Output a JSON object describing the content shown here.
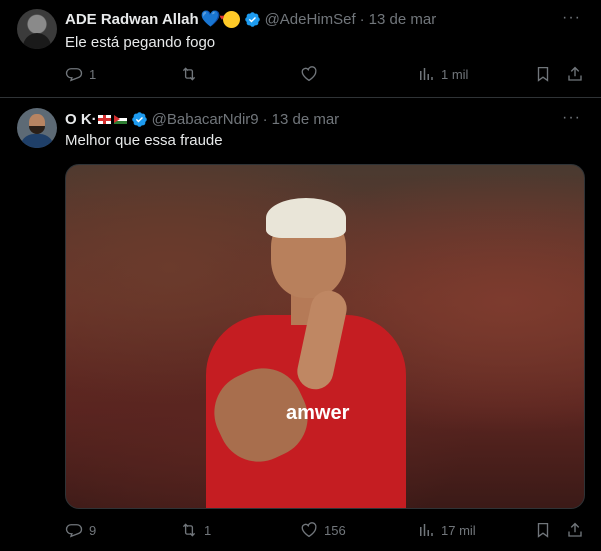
{
  "tweets": [
    {
      "author_name": "ADE Radwan Allah",
      "handle": "@AdeHimSef",
      "date": "13 de mar",
      "text": "Ele está pegando fogo",
      "replies": "1",
      "reposts": "",
      "likes": "",
      "views": "1 mil",
      "verified": true
    },
    {
      "author_name": "O K·",
      "handle": "@BabacarNdir9",
      "date": "13 de mar",
      "text": "Melhor que essa fraude",
      "replies": "9",
      "reposts": "1",
      "likes": "156",
      "views": "17 mil",
      "verified": true,
      "media_sponsor_text": "amwer"
    }
  ],
  "separator": "·",
  "more_label": "···",
  "colors": {
    "background": "#000000",
    "text": "#e7e9ea",
    "muted": "#71767b",
    "verified": "#1d9bf0",
    "border": "#2f3336"
  }
}
